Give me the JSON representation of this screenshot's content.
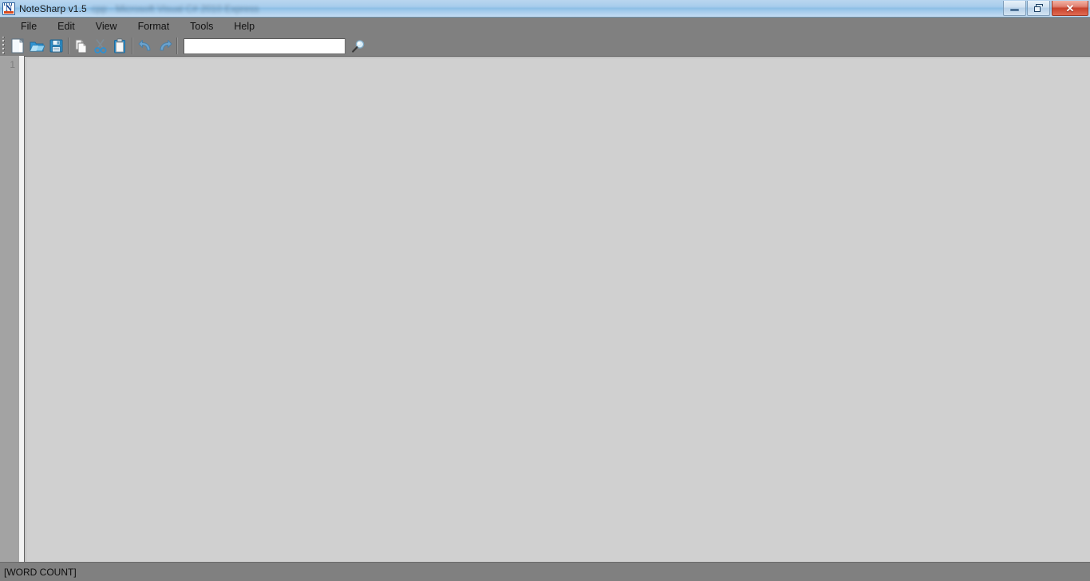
{
  "window": {
    "app_icon": "notesharp-n-icon",
    "title": "NoteSharp v1.5",
    "title_suffix_blurred": "cpp - Microsoft Visual C# 2010 Express",
    "controls": {
      "minimize_label": "—",
      "maximize_label": "❐",
      "close_label": "✕"
    },
    "accent_title_color": "#a8cdec",
    "chrome_color": "#808080",
    "close_button_color": "#c7422c"
  },
  "menubar": {
    "items": [
      {
        "label": "File",
        "name": "menu-file"
      },
      {
        "label": "Edit",
        "name": "menu-edit"
      },
      {
        "label": "View",
        "name": "menu-view"
      },
      {
        "label": "Format",
        "name": "menu-format"
      },
      {
        "label": "Tools",
        "name": "menu-tools"
      },
      {
        "label": "Help",
        "name": "menu-help"
      }
    ]
  },
  "toolbar": {
    "grip": "toolbar-grip-handle",
    "buttons": [
      {
        "icon": "new-document-icon",
        "name": "new-button",
        "tooltip": "New"
      },
      {
        "icon": "open-folder-icon",
        "name": "open-button",
        "tooltip": "Open"
      },
      {
        "icon": "save-floppy-icon",
        "name": "save-button",
        "tooltip": "Save"
      },
      {
        "icon": "copy-icon",
        "name": "copy-button",
        "tooltip": "Copy"
      },
      {
        "icon": "cut-scissors-icon",
        "name": "cut-button",
        "tooltip": "Cut"
      },
      {
        "icon": "paste-clipboard-icon",
        "name": "paste-button",
        "tooltip": "Paste"
      },
      {
        "icon": "undo-arrow-icon",
        "name": "undo-button",
        "tooltip": "Undo"
      },
      {
        "icon": "redo-arrow-icon",
        "name": "redo-button",
        "tooltip": "Redo"
      }
    ],
    "search": {
      "value": "",
      "placeholder": "",
      "button_icon": "magnifier-icon",
      "button_name": "search-button"
    }
  },
  "editor": {
    "line_numbers": [
      "1"
    ],
    "content": "",
    "background_color": "#d0d0d0",
    "gutter_color": "#a3a3a3"
  },
  "statusbar": {
    "word_count_text": "[WORD COUNT]"
  }
}
